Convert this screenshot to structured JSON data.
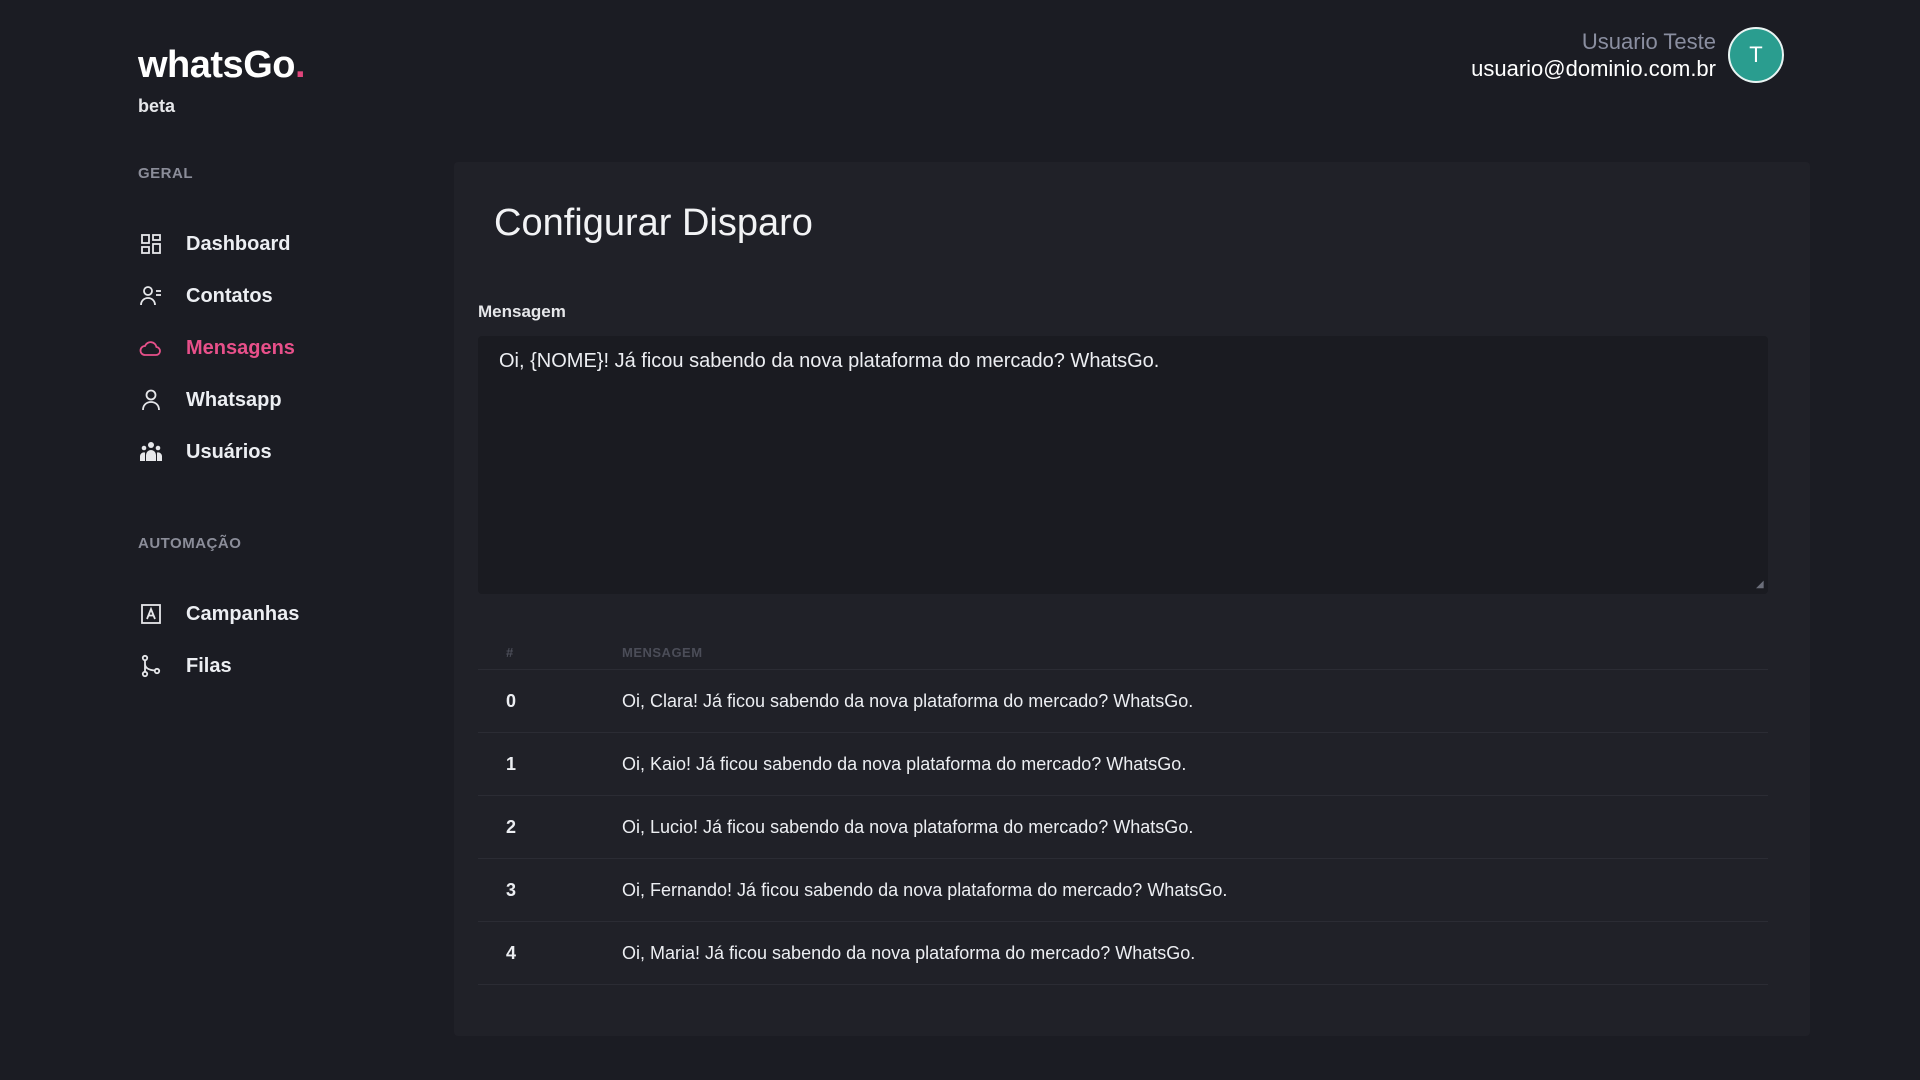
{
  "brand": {
    "name": "whatsGo",
    "dot": ".",
    "tag": "beta"
  },
  "colors": {
    "accent": "#e8508a",
    "avatar": "#2a9d8f",
    "background": "#1b1c23",
    "card": "#202128"
  },
  "sidebar": {
    "sections": [
      {
        "title": "GERAL",
        "items": [
          {
            "label": "Dashboard",
            "icon": "dashboard-icon",
            "active": false
          },
          {
            "label": "Contatos",
            "icon": "contacts-icon",
            "active": false
          },
          {
            "label": "Mensagens",
            "icon": "cloud-icon",
            "active": true
          },
          {
            "label": "Whatsapp",
            "icon": "user-icon",
            "active": false
          },
          {
            "label": "Usuários",
            "icon": "users-group-icon",
            "active": false
          }
        ]
      },
      {
        "title": "AUTOMAÇÃO",
        "items": [
          {
            "label": "Campanhas",
            "icon": "campaign-icon",
            "active": false
          },
          {
            "label": "Filas",
            "icon": "queue-branch-icon",
            "active": false
          }
        ]
      }
    ]
  },
  "header": {
    "user_name": "Usuario Teste",
    "user_email": "usuario@dominio.com.br",
    "avatar_initial": "T"
  },
  "main": {
    "title": "Configurar Disparo",
    "message_label": "Mensagem",
    "message_value": "Oi, {NOME}! Já ficou sabendo da nova plataforma do mercado? WhatsGo.",
    "table": {
      "headers": [
        "#",
        "MENSAGEM"
      ],
      "rows": [
        {
          "idx": "0",
          "message": "Oi, Clara! Já ficou sabendo da nova plataforma do mercado? WhatsGo."
        },
        {
          "idx": "1",
          "message": "Oi, Kaio! Já ficou sabendo da nova plataforma do mercado? WhatsGo."
        },
        {
          "idx": "2",
          "message": "Oi, Lucio! Já ficou sabendo da nova plataforma do mercado? WhatsGo."
        },
        {
          "idx": "3",
          "message": "Oi, Fernando! Já ficou sabendo da nova plataforma do mercado? WhatsGo."
        },
        {
          "idx": "4",
          "message": "Oi, Maria! Já ficou sabendo da nova plataforma do mercado? WhatsGo."
        }
      ]
    }
  }
}
